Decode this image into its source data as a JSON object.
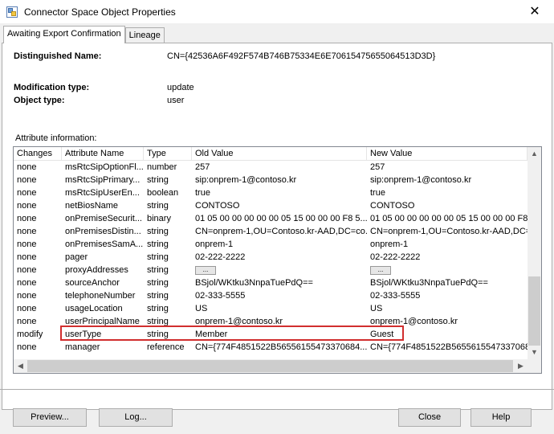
{
  "window": {
    "title": "Connector Space Object Properties"
  },
  "tabs": [
    {
      "label": "Awaiting Export Confirmation"
    },
    {
      "label": "Lineage"
    }
  ],
  "details": {
    "dn_label": "Distinguished Name:",
    "dn_value": "CN={42536A6F492F574B746B75334E6E70615475655064513D3D}",
    "modtype_label": "Modification type:",
    "modtype_value": "update",
    "objtype_label": "Object type:",
    "objtype_value": "user",
    "attr_info_label": "Attribute information:"
  },
  "grid": {
    "columns": [
      "Changes",
      "Attribute Name",
      "Type",
      "Old Value",
      "New Value"
    ],
    "rows": [
      [
        "none",
        "msRtcSipOptionFl...",
        "number",
        "257",
        "257"
      ],
      [
        "none",
        "msRtcSipPrimary...",
        "string",
        "sip:onprem-1@contoso.kr",
        "sip:onprem-1@contoso.kr"
      ],
      [
        "none",
        "msRtcSipUserEn...",
        "boolean",
        "true",
        "true"
      ],
      [
        "none",
        "netBiosName",
        "string",
        "CONTOSO",
        "CONTOSO"
      ],
      [
        "none",
        "onPremiseSecurit...",
        "binary",
        "01 05 00 00 00 00 00 05 15 00 00 00 F8 5...",
        "01 05 00 00 00 00 00 05 15 00 00 00 F8 5"
      ],
      [
        "none",
        "onPremisesDistin...",
        "string",
        "CN=onprem-1,OU=Contoso.kr-AAD,DC=co...",
        "CN=onprem-1,OU=Contoso.kr-AAD,DC=co"
      ],
      [
        "none",
        "onPremisesSamA...",
        "string",
        "onprem-1",
        "onprem-1"
      ],
      [
        "none",
        "pager",
        "string",
        "02-222-2222",
        "02-222-2222"
      ],
      [
        "none",
        "proxyAddresses",
        "string",
        "...",
        "..."
      ],
      [
        "none",
        "sourceAnchor",
        "string",
        "BSjol/WKtku3NnpaTuePdQ==",
        "BSjol/WKtku3NnpaTuePdQ=="
      ],
      [
        "none",
        "telephoneNumber",
        "string",
        "02-333-5555",
        "02-333-5555"
      ],
      [
        "none",
        "usageLocation",
        "string",
        "US",
        "US"
      ],
      [
        "none",
        "userPrincipalName",
        "string",
        "onprem-1@contoso.kr",
        "onprem-1@contoso.kr"
      ],
      [
        "modify",
        "userType",
        "string",
        "Member",
        "Guest"
      ],
      [
        "none",
        "manager",
        "reference",
        "CN={774F4851522B56556155473370684...",
        "CN={774F4851522B5655615547337068"
      ]
    ]
  },
  "buttons": {
    "preview": "Preview...",
    "log": "Log...",
    "close": "Close",
    "help": "Help"
  },
  "icons": {
    "close": "✕",
    "up": "▲",
    "down": "▼",
    "left": "◀",
    "right": "▶"
  }
}
